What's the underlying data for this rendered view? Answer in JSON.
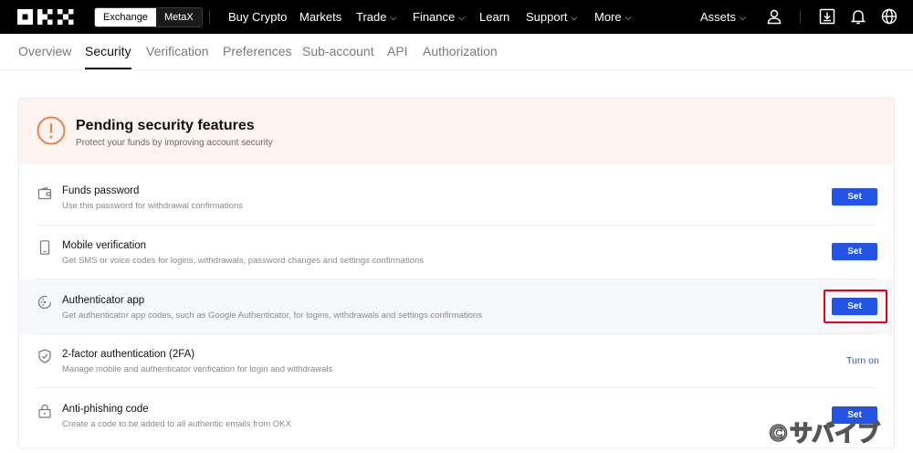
{
  "brand": {
    "logo_text": "OKX",
    "accent_color": "#2354e6",
    "highlight_color": "#e4001b"
  },
  "switcher": {
    "options": [
      "Exchange",
      "MetaX"
    ],
    "active": "Exchange"
  },
  "nav": {
    "items": [
      {
        "label": "Buy Crypto"
      },
      {
        "label": "Markets"
      },
      {
        "label": "Trade"
      },
      {
        "label": "Finance"
      },
      {
        "label": "Learn"
      },
      {
        "label": "Support"
      },
      {
        "label": "More"
      }
    ],
    "assets_label": "Assets",
    "icons": [
      "user-icon",
      "download-icon",
      "bell-icon",
      "globe-icon"
    ]
  },
  "tabs": {
    "items": [
      "Overview",
      "Security",
      "Verification",
      "Preferences",
      "Sub-account",
      "API",
      "Authorization"
    ],
    "active": "Security"
  },
  "banner": {
    "title": "Pending security features",
    "subtitle": "Protect your funds by improving account security",
    "icon": "warning-icon"
  },
  "features": [
    {
      "icon": "wallet-icon",
      "title": "Funds password",
      "desc": "Use this password for withdrawal confirmations",
      "action": "Set",
      "action_type": "button"
    },
    {
      "icon": "phone-icon",
      "title": "Mobile verification",
      "desc": "Get SMS or voice codes for logins, withdrawals, password changes and settings confirmations",
      "action": "Set",
      "action_type": "button"
    },
    {
      "icon": "authenticator-icon",
      "title": "Authenticator app",
      "desc": "Get authenticator app codes, such as Google Authenticator, for logins, withdrawals and settings confirmations",
      "action": "Set",
      "action_type": "button",
      "highlighted": true
    },
    {
      "icon": "shield-icon",
      "title": "2-factor authentication (2FA)",
      "desc": "Manage mobile and authenticator verification for login and withdrawals",
      "action": "Turn on",
      "action_type": "link"
    },
    {
      "icon": "lock-icon",
      "title": "Anti-phishing code",
      "desc": "Create a code to be added to all authentic emails from OKX",
      "action": "Set",
      "action_type": "button"
    }
  ],
  "watermark": "©サバイブ"
}
